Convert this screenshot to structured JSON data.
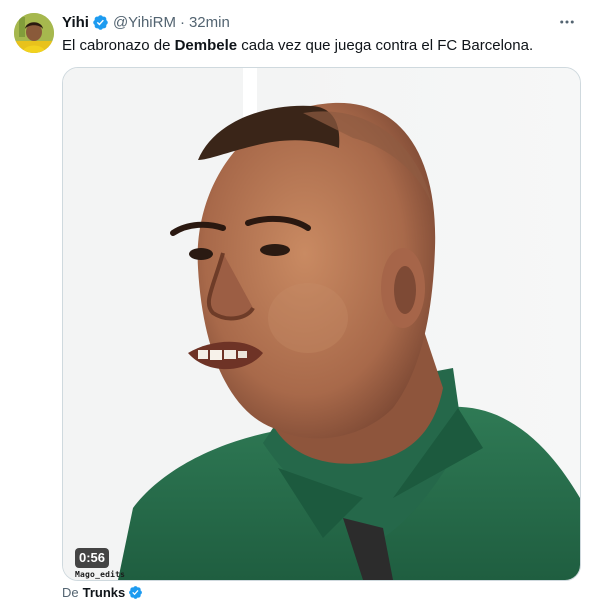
{
  "tweet": {
    "author_name": "Yihi",
    "handle": "@YihiRM",
    "separator": "·",
    "time": "32min",
    "text_before": "El cabronazo de ",
    "text_bold": "Dembele",
    "text_after": " cada vez que juega contra el FC Barcelona.",
    "verified_icon": "verified-badge-icon",
    "more_icon": "more-options-icon"
  },
  "media": {
    "type": "video",
    "duration": "0:56",
    "watermark": "Mago_edits"
  },
  "source": {
    "prefix": "De",
    "name": "Trunks"
  },
  "colors": {
    "verified_blue": "#1d9bf0",
    "secondary_text": "#536471",
    "primary_text": "#0f1419",
    "border": "#cfd9de"
  }
}
